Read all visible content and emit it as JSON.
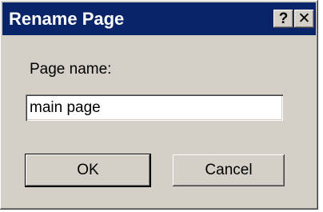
{
  "dialog": {
    "title": "Rename Page",
    "help_glyph": "?",
    "close_glyph": "✕",
    "field_label": "Page name:",
    "field_value": "main page",
    "ok_label": "OK",
    "cancel_label": "Cancel"
  },
  "colors": {
    "titlebar": "#0a246a",
    "face": "#d4d0c8",
    "title_text": "#ffffff"
  },
  "icons": {
    "help": "help-icon",
    "close": "close-icon"
  }
}
